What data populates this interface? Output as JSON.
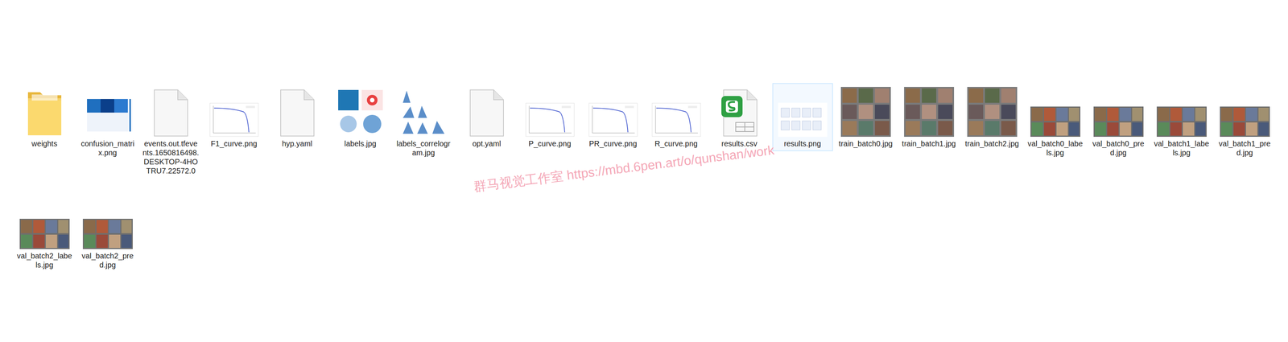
{
  "files": [
    {
      "name": "weights",
      "kind": "folder",
      "selected": false
    },
    {
      "name": "confusion_matrix.png",
      "kind": "matrix",
      "selected": false
    },
    {
      "name": "events.out.tfevents.1650816498.DESKTOP-4HOTRU7.22572.0",
      "kind": "file",
      "selected": false
    },
    {
      "name": "F1_curve.png",
      "kind": "chart",
      "selected": false
    },
    {
      "name": "hyp.yaml",
      "kind": "file",
      "selected": false
    },
    {
      "name": "labels.jpg",
      "kind": "plot",
      "selected": false
    },
    {
      "name": "labels_correlogram.jpg",
      "kind": "correlogram",
      "selected": false
    },
    {
      "name": "opt.yaml",
      "kind": "file",
      "selected": false
    },
    {
      "name": "P_curve.png",
      "kind": "chart",
      "selected": false
    },
    {
      "name": "PR_curve.png",
      "kind": "chart",
      "selected": false
    },
    {
      "name": "R_curve.png",
      "kind": "chart",
      "selected": false
    },
    {
      "name": "results.csv",
      "kind": "spreadsheet",
      "selected": false
    },
    {
      "name": "results.png",
      "kind": "results",
      "selected": true
    },
    {
      "name": "train_batch0.jpg",
      "kind": "photo",
      "selected": false
    },
    {
      "name": "train_batch1.jpg",
      "kind": "photo",
      "selected": false
    },
    {
      "name": "train_batch2.jpg",
      "kind": "photo",
      "selected": false
    },
    {
      "name": "val_batch0_labels.jpg",
      "kind": "photo-wide",
      "selected": false
    },
    {
      "name": "val_batch0_pred.jpg",
      "kind": "photo-wide",
      "selected": false
    },
    {
      "name": "val_batch1_labels.jpg",
      "kind": "photo-wide",
      "selected": false
    },
    {
      "name": "val_batch1_pred.jpg",
      "kind": "photo-wide",
      "selected": false
    },
    {
      "name": "val_batch2_labels.jpg",
      "kind": "photo-wide",
      "selected": false
    },
    {
      "name": "val_batch2_pred.jpg",
      "kind": "photo-wide",
      "selected": false
    }
  ],
  "watermark": "群马视觉工作室 https://mbd.6pen.art/o/qunshan/work"
}
